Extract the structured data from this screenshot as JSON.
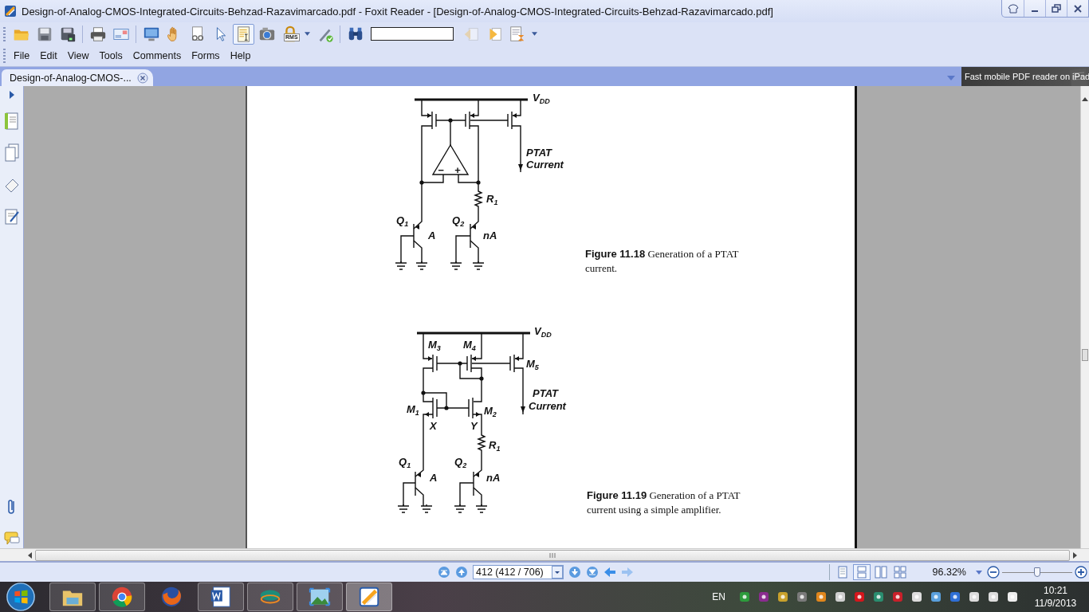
{
  "window": {
    "title": "Design-of-Analog-CMOS-Integrated-Circuits-Behzad-Razavimarcado.pdf - Foxit Reader - [Design-of-Analog-CMOS-Integrated-Circuits-Behzad-Razavimarcado.pdf]"
  },
  "toolbar": {
    "tools": [
      {
        "kind": "open",
        "selected": false
      },
      {
        "kind": "save",
        "selected": false
      },
      {
        "kind": "save_all",
        "selected": false
      },
      {
        "kind": "print",
        "selected": false
      },
      {
        "kind": "email",
        "selected": false
      },
      {
        "kind": "fullscreen",
        "selected": false
      },
      {
        "kind": "hand",
        "selected": false
      },
      {
        "kind": "inspect",
        "selected": false
      },
      {
        "kind": "select",
        "selected": false
      },
      {
        "kind": "select_text",
        "selected": true
      },
      {
        "kind": "snapshot",
        "selected": false
      },
      {
        "kind": "rms",
        "selected": false
      },
      {
        "kind": "sign",
        "selected": false
      },
      {
        "kind": "find",
        "selected": false
      }
    ],
    "rms_label": "RMS",
    "after_search": [
      {
        "kind": "find_prev",
        "disabled": true
      },
      {
        "kind": "find_next",
        "disabled": false
      },
      {
        "kind": "typewriter",
        "disabled": false
      }
    ]
  },
  "menu": [
    "File",
    "Edit",
    "View",
    "Tools",
    "Comments",
    "Forms",
    "Help"
  ],
  "tabs": [
    {
      "label": "Design-of-Analog-CMOS-...",
      "selected": true
    }
  ],
  "ad_banner": "Fast mobile PDF reader on iPad",
  "figures": [
    {
      "kind": "ptat_opamp",
      "labels": [
        "V$_{DD}$",
        "PTAT",
        "−",
        "+",
        "Current",
        "R$_{1}$",
        "Q$_{1}$",
        "A",
        "Q$_{2}$",
        "nA"
      ],
      "caption": "**Figure 11.18**  Generation of a PTAT current."
    },
    {
      "kind": "ptat_simple_amp",
      "labels": [
        "V$_{DD}$",
        "M$_{3}$",
        "M$_{4}$",
        "M$_{5}$",
        "PTAT",
        "Current",
        "M$_{1}$",
        "M$_{2}$",
        "X",
        "Y",
        "R$_{1}$",
        "Q$_{1}$",
        "A",
        "Q$_{2}$",
        "nA"
      ],
      "caption": "**Figure 11.19**  Generation of a PTAT current using a simple amplifier."
    }
  ],
  "status_bar": {
    "nav": [
      {
        "kind": "first",
        "disabled": false
      },
      {
        "kind": "prev",
        "disabled": false
      }
    ],
    "page_field": "412 (412 / 706)",
    "nav_after": [
      {
        "kind": "next",
        "disabled": false
      },
      {
        "kind": "last",
        "disabled": false
      },
      {
        "kind": "back",
        "disabled": false
      },
      {
        "kind": "forward",
        "disabled": true
      }
    ],
    "view_modes": [
      {
        "kind": "single",
        "selected": false
      },
      {
        "kind": "continuous",
        "selected": true
      },
      {
        "kind": "facing",
        "selected": false
      },
      {
        "kind": "continuous_facing",
        "selected": false
      }
    ],
    "zoom": "96.32%",
    "zoom_slider": {
      "level": 0.5
    }
  },
  "taskbar": {
    "apps": [
      {
        "kind": "explorer",
        "running": true,
        "selected": false
      },
      {
        "kind": "chrome",
        "running": true,
        "selected": false
      },
      {
        "kind": "firefox",
        "running": false,
        "selected": false
      },
      {
        "kind": "word",
        "running": true,
        "selected": false
      },
      {
        "kind": "ellipse",
        "running": true,
        "selected": false
      },
      {
        "kind": "photos",
        "running": true,
        "selected": false
      },
      {
        "kind": "foxit",
        "running": true,
        "selected": true
      }
    ],
    "language": "EN",
    "time": "10:21",
    "date": "11/9/2013"
  }
}
